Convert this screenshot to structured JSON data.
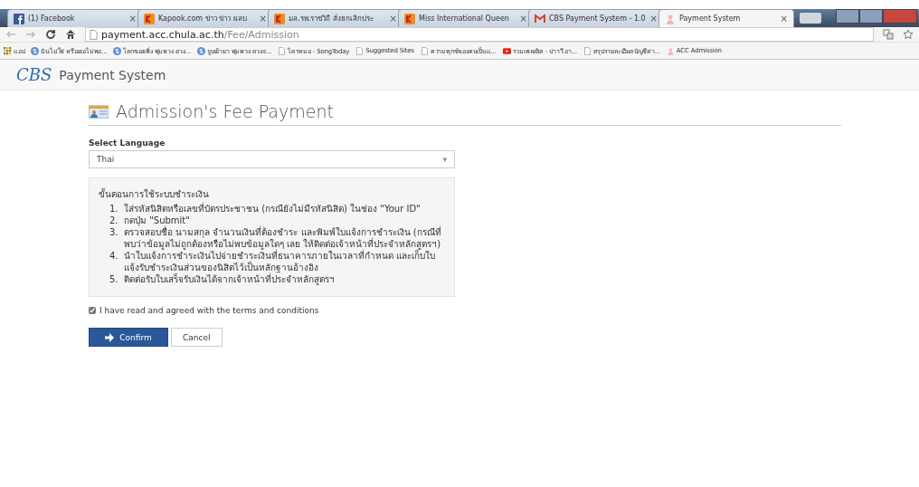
{
  "browser": {
    "tabs": [
      {
        "title": "(1) Facebook",
        "selected": false
      },
      {
        "title": "Kapook.com ข่าว ข่าว ผลบ",
        "selected": false
      },
      {
        "title": "มล.รพ.ราชวิถี สั่งยกเลิกประ",
        "selected": false
      },
      {
        "title": "Miss International Queen",
        "selected": false
      },
      {
        "title": "CBS Payment System - 1.0",
        "selected": false
      },
      {
        "title": "Payment System",
        "selected": true
      }
    ],
    "tab_close": "×",
    "url_host": "payment.acc.chula.ac.th",
    "url_path": "/Fee/Admission",
    "bookmarks": [
      {
        "label": "แอป"
      },
      {
        "label": "ฉันไม่ใช่ หรือเธอไม่พอ..."
      },
      {
        "label": "โลกของเพิ่ง พุ่มพวง ดวง..."
      },
      {
        "label": "จูบเย้ายา พุ่มพวง ดวงจ..."
      },
      {
        "label": "ไดรหมอ - SongToday"
      },
      {
        "label": "Suggested Sites"
      },
      {
        "label": "ความทุกข์ของคนเป็นแ..."
      },
      {
        "label": "รวมเพลงฮิต - ปาาวี อา..."
      },
      {
        "label": "สรุปรายละเอียดบัญชีค่า..."
      },
      {
        "label": "ACC Admission"
      }
    ]
  },
  "app": {
    "logo": "CBS",
    "name": "Payment System"
  },
  "page": {
    "title": "Admission's Fee Payment",
    "language_label": "Select Language",
    "language_value": "Thai",
    "select_caret": "▾",
    "steps_heading": "ขั้นตอนการใช้ระบบชำระเงิน",
    "steps": [
      {
        "number": "1.",
        "text": "ใส่รหัสนิสิตหรือเลขที่บัตรประชาชน (กรณียังไม่มีรหัสนิสิต) ในช่อง \"Your ID\""
      },
      {
        "number": "2.",
        "text": "กดปุ่ม \"Submit\""
      },
      {
        "number": "3.",
        "text": "ตรวจสอบชื่อ นามสกุล จำนวนเงินที่ต้องชำระ และพิมพ์ใบแจ้งการชำระเงิน (กรณีที่พบว่าข้อมูลไม่ถูกต้องหรือไม่พบข้อมูลใดๆ เลย ให้ติดต่อเจ้าหน้าที่ประจำหลักสูตรฯ)"
      },
      {
        "number": "4.",
        "text": "นำใบแจ้งการชำระเงินไปจ่ายชำระเงินที่ธนาคารภายในเวลาที่กำหนด และเก็บใบแจ้งรับชำระเงินส่วนของนิสิตไว้เป็นหลักฐานอ้างอิง"
      },
      {
        "number": "5.",
        "text": "ติดต่อรับใบเสร็จรับเงินได้จากเจ้าหน้าที่ประจำหลักสูตรฯ"
      }
    ],
    "agree": {
      "label": "I have read and agreed with the terms and conditions",
      "checked": true
    },
    "buttons": [
      {
        "label": "Confirm",
        "kind": "primary"
      },
      {
        "label": "Cancel",
        "kind": "default"
      }
    ]
  }
}
